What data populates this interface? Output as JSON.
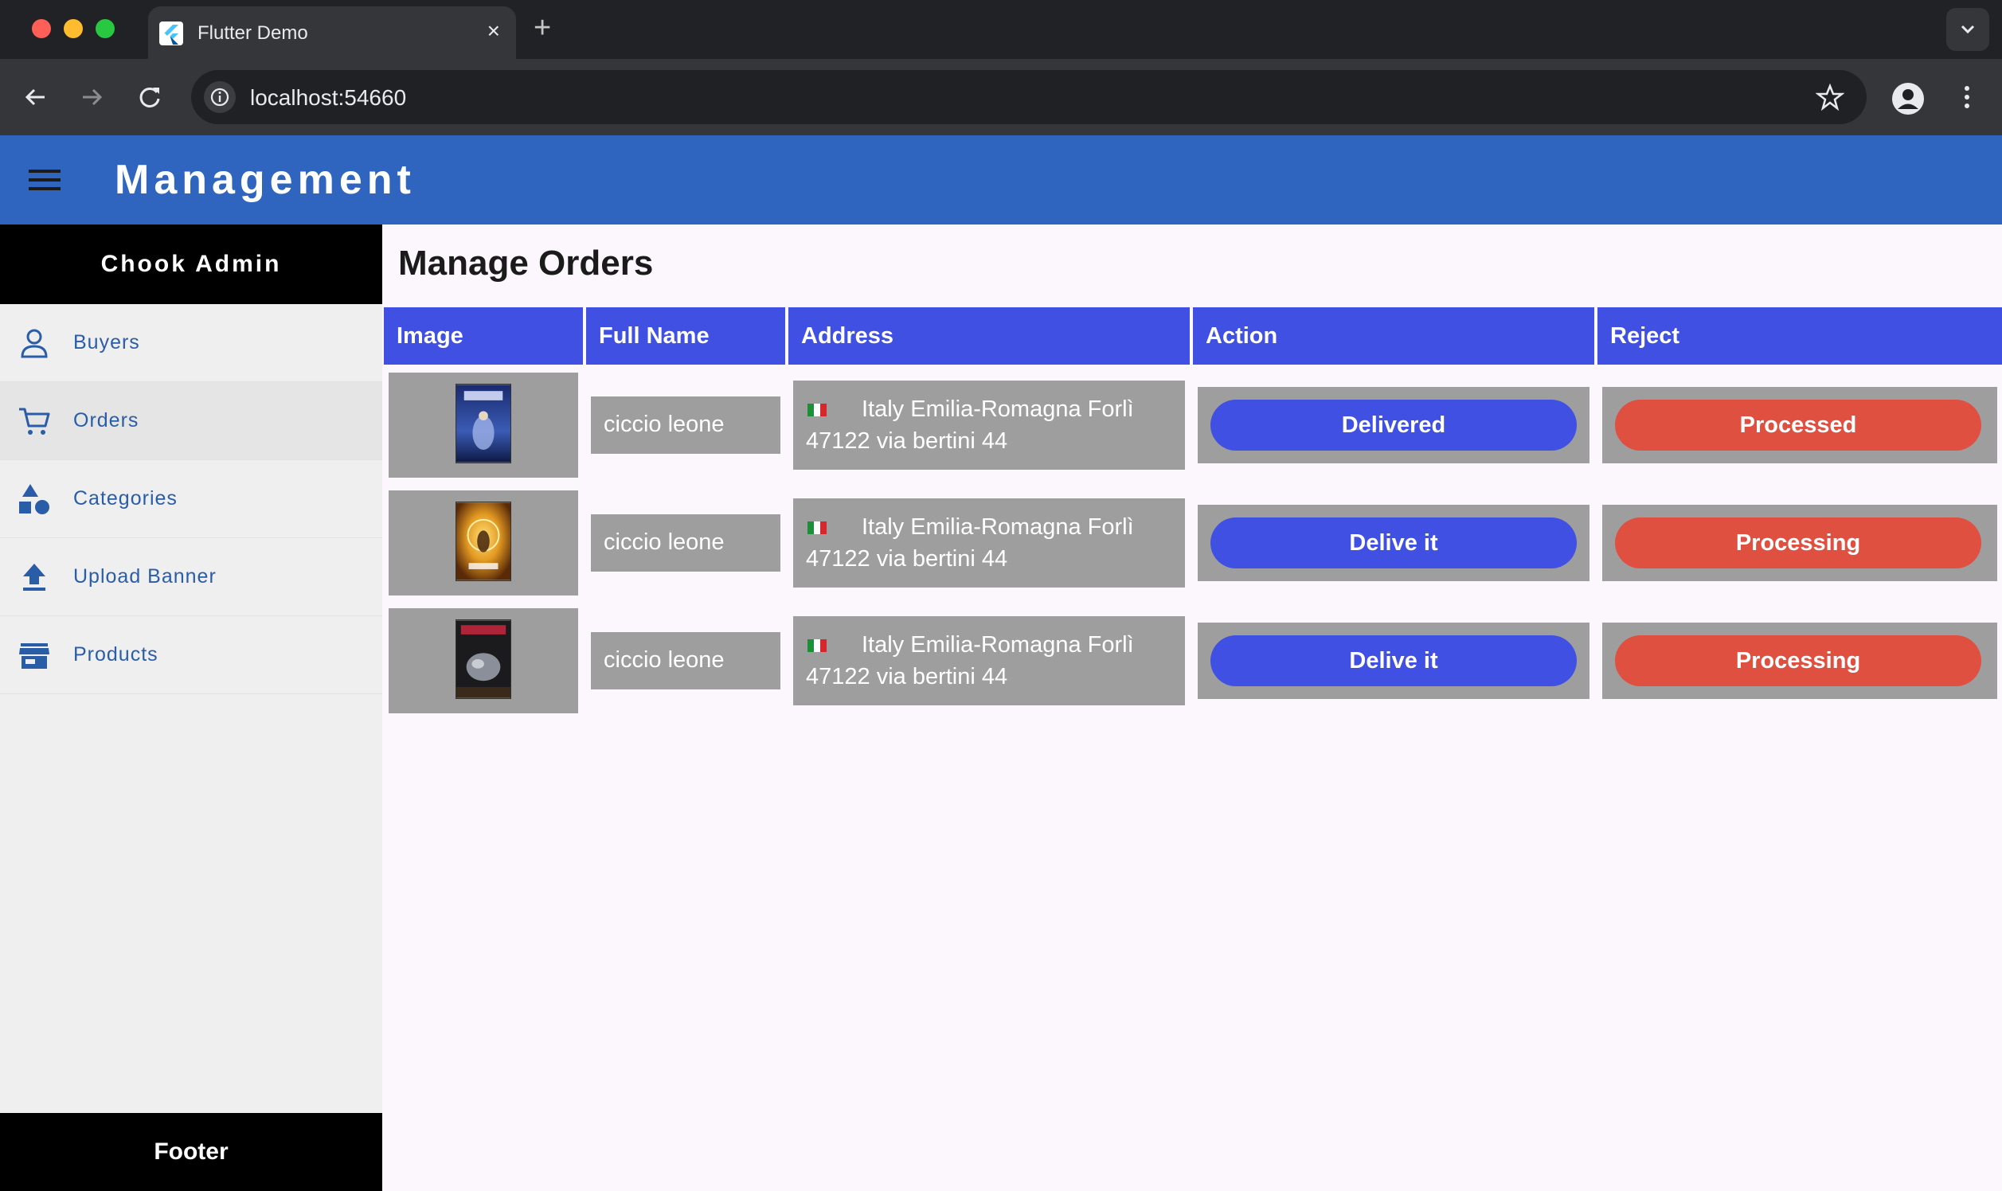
{
  "browser": {
    "tab_title": "Flutter Demo",
    "tab_close": "×",
    "new_tab": "+",
    "url": "localhost:54660"
  },
  "appbar": {
    "title": "Management"
  },
  "sidebar": {
    "header": "Chook Admin",
    "items": [
      {
        "label": "Buyers",
        "icon": "person-icon"
      },
      {
        "label": "Orders",
        "icon": "cart-icon"
      },
      {
        "label": "Categories",
        "icon": "category-icon"
      },
      {
        "label": "Upload Banner",
        "icon": "upload-icon"
      },
      {
        "label": "Products",
        "icon": "store-icon"
      }
    ],
    "footer": "Footer"
  },
  "main": {
    "title": "Manage Orders",
    "columns": [
      "Image",
      "Full Name",
      "Address",
      "Action",
      "Reject"
    ],
    "rows": [
      {
        "full_name": "ciccio leone",
        "address_line1": "Italy Emilia-Romagna Forlì",
        "address_line2": "47122 via bertini 44",
        "action": "Delivered",
        "reject": "Processed"
      },
      {
        "full_name": "ciccio leone",
        "address_line1": "Italy Emilia-Romagna Forlì",
        "address_line2": "47122 via bertini 44",
        "action": "Delive it",
        "reject": "Processing"
      },
      {
        "full_name": "ciccio leone",
        "address_line1": "Italy Emilia-Romagna Forlì",
        "address_line2": "47122 via bertini 44",
        "action": "Delive it",
        "reject": "Processing"
      }
    ]
  },
  "colors": {
    "appbar": "#2f65bf",
    "header_blue": "#3f50e3",
    "reject_red": "#e05040",
    "cell_grey": "#9e9e9e"
  }
}
